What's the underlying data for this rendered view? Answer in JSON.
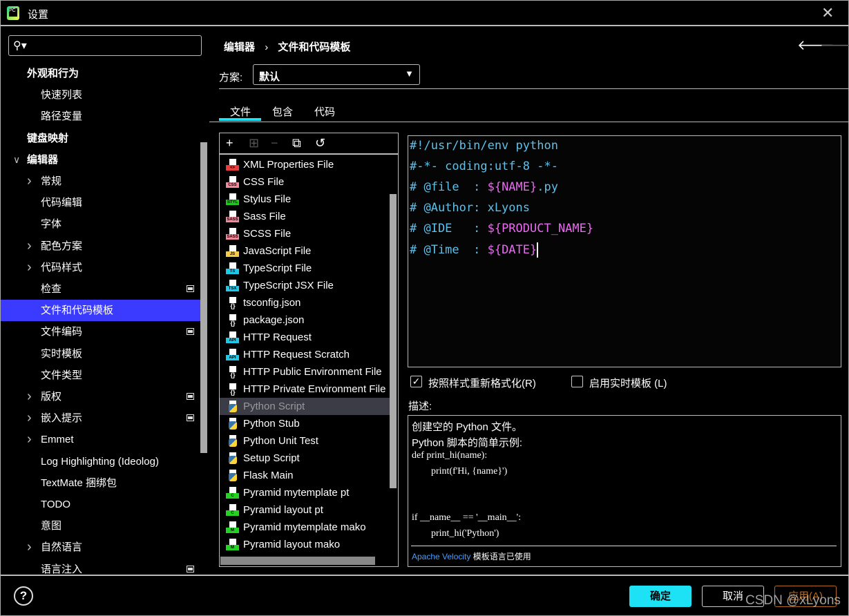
{
  "window": {
    "title": "设置",
    "close": "✕",
    "app_icon_text": "PC"
  },
  "search": {
    "icon": "⚲▾",
    "value": "",
    "placeholder": ""
  },
  "sidebar": {
    "items": [
      {
        "label": "外观和行为",
        "depth": 0,
        "chevron": "none",
        "bold": true
      },
      {
        "label": "快速列表",
        "depth": 1,
        "chevron": "none"
      },
      {
        "label": "路径变量",
        "depth": 1,
        "chevron": "none"
      },
      {
        "label": "键盘映射",
        "depth": 0,
        "chevron": "none",
        "bold": true
      },
      {
        "label": "编辑器",
        "depth": 0,
        "chevron": "down",
        "bold": true
      },
      {
        "label": "常规",
        "depth": 1,
        "chevron": "right"
      },
      {
        "label": "代码编辑",
        "depth": 1,
        "chevron": "none"
      },
      {
        "label": "字体",
        "depth": 1,
        "chevron": "none"
      },
      {
        "label": "配色方案",
        "depth": 1,
        "chevron": "right"
      },
      {
        "label": "代码样式",
        "depth": 1,
        "chevron": "right"
      },
      {
        "label": "检查",
        "depth": 1,
        "chevron": "none",
        "badge": true
      },
      {
        "label": "文件和代码模板",
        "depth": 1,
        "chevron": "none",
        "selected": true
      },
      {
        "label": "文件编码",
        "depth": 1,
        "chevron": "none",
        "badge": true
      },
      {
        "label": "实时模板",
        "depth": 1,
        "chevron": "none"
      },
      {
        "label": "文件类型",
        "depth": 1,
        "chevron": "none"
      },
      {
        "label": "版权",
        "depth": 1,
        "chevron": "right",
        "badge": true
      },
      {
        "label": "嵌入提示",
        "depth": 1,
        "chevron": "right",
        "badge": true
      },
      {
        "label": "Emmet",
        "depth": 1,
        "chevron": "right"
      },
      {
        "label": "Log Highlighting (Ideolog)",
        "depth": 1,
        "chevron": "none"
      },
      {
        "label": "TextMate 捆绑包",
        "depth": 1,
        "chevron": "none"
      },
      {
        "label": "TODO",
        "depth": 1,
        "chevron": "none"
      },
      {
        "label": "意图",
        "depth": 1,
        "chevron": "none"
      },
      {
        "label": "自然语言",
        "depth": 1,
        "chevron": "right"
      },
      {
        "label": "语言注入",
        "depth": 1,
        "chevron": "none",
        "badge": true
      }
    ]
  },
  "header": {
    "breadcrumb": [
      "编辑器",
      "›",
      "文件和代码模板"
    ],
    "back": "🡐",
    "forward": "🡒"
  },
  "scheme": {
    "label": "方案:",
    "value": "默认",
    "arrow": "▼"
  },
  "tabs": [
    {
      "label": "文件",
      "active": true
    },
    {
      "label": "包含"
    },
    {
      "label": "代码"
    }
  ],
  "toolbar": {
    "add": "+",
    "add_child": "⊞",
    "remove": "−",
    "copy": "⧉",
    "reset": "↺"
  },
  "templates": [
    {
      "name": "XML Properties File",
      "tag": "<>",
      "color": "#e83b3b"
    },
    {
      "name": "CSS File",
      "tag": "CSS",
      "color": "#f08a9a"
    },
    {
      "name": "Stylus File",
      "tag": "STYL",
      "color": "#22c322"
    },
    {
      "name": "Sass File",
      "tag": "SASS",
      "color": "#f08a9a"
    },
    {
      "name": "SCSS File",
      "tag": "SASS",
      "color": "#f08a9a"
    },
    {
      "name": "JavaScript File",
      "tag": "JS",
      "color": "#f5c94a"
    },
    {
      "name": "TypeScript File",
      "tag": "TS",
      "color": "#1ec8e8"
    },
    {
      "name": "TypeScript JSX File",
      "tag": "TSX",
      "color": "#1ec8e8"
    },
    {
      "name": "tsconfig.json",
      "tag": "{}",
      "color": "#000000"
    },
    {
      "name": "package.json",
      "tag": "{}",
      "color": "#000000"
    },
    {
      "name": "HTTP Request",
      "tag": "API",
      "color": "#1ec8e8"
    },
    {
      "name": "HTTP Request Scratch",
      "tag": "API",
      "color": "#1ec8e8"
    },
    {
      "name": "HTTP Public Environment File",
      "tag": "{}",
      "color": "#000000"
    },
    {
      "name": "HTTP Private Environment File",
      "tag": "{}",
      "color": "#000000"
    },
    {
      "name": "Python Script",
      "tag": "py",
      "color": "",
      "selected": true
    },
    {
      "name": "Python Stub",
      "tag": "py",
      "color": ""
    },
    {
      "name": "Python Unit Test",
      "tag": "py",
      "color": ""
    },
    {
      "name": "Setup Script",
      "tag": "py",
      "color": ""
    },
    {
      "name": "Flask Main",
      "tag": "py",
      "color": ""
    },
    {
      "name": "Pyramid mytemplate pt",
      "tag": "C",
      "color": "#22d322"
    },
    {
      "name": "Pyramid layout pt",
      "tag": "C",
      "color": "#22d322"
    },
    {
      "name": "Pyramid mytemplate mako",
      "tag": "M",
      "color": "#22d322"
    },
    {
      "name": "Pyramid layout mako",
      "tag": "M",
      "color": "#22d322"
    }
  ],
  "editor": {
    "lines": [
      [
        {
          "t": "#!/usr/bin/env python"
        }
      ],
      [
        {
          "t": "#-*- coding:utf-8 -*-"
        }
      ],
      [
        {
          "t": "# @file  : "
        },
        {
          "t": "${NAME}",
          "v": true
        },
        {
          "t": ".py"
        }
      ],
      [
        {
          "t": "# @Author: xLyons"
        }
      ],
      [
        {
          "t": "# @IDE   : "
        },
        {
          "t": "${PRODUCT_NAME}",
          "v": true
        }
      ],
      [
        {
          "t": "# @Time  : "
        },
        {
          "t": "${DATE}",
          "v": true
        }
      ]
    ],
    "colors": {
      "comment": "#5fc0ea",
      "variable": "#e86bf0"
    }
  },
  "options": {
    "reformat": {
      "label": "按照样式重新格式化(R)",
      "checked": true
    },
    "live_templates": {
      "label": "启用实时模板 (L)",
      "checked": false
    }
  },
  "description": {
    "label": "描述:",
    "lines": [
      {
        "t": "创建空的 Python 文件。",
        "mono": false
      },
      {
        "t": "Python 脚本的简单示例:",
        "mono": false
      },
      {
        "t": "def print_hi(name):",
        "mono": true
      },
      {
        "t": "        print(f'Hi, {name}')",
        "mono": true
      },
      {
        "t": "",
        "mono": true
      },
      {
        "t": "",
        "mono": true
      },
      {
        "t": "if __name__ == '__main__':",
        "mono": true
      },
      {
        "t": "        print_hi('Python')",
        "mono": true
      }
    ],
    "footer_link": "Apache Velocity",
    "footer_text": " 模板语言已使用"
  },
  "footer": {
    "help": "?",
    "ok": "确定",
    "cancel": "取消",
    "apply": "应用(A)",
    "watermark": "CSDN @xLyons"
  },
  "colors": {
    "accent": "#1de1f5",
    "selection": "#3b3bff",
    "apply": "#b56a20"
  }
}
